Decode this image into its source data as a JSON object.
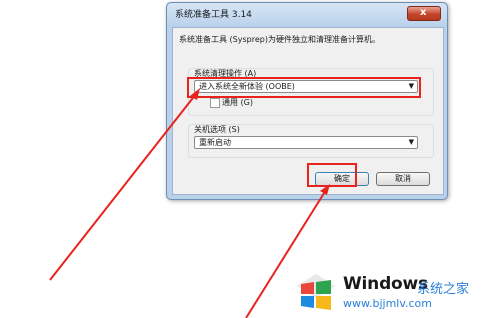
{
  "dialog": {
    "title": "系统准备工具 3.14",
    "close_label": "x",
    "description": "系统准备工具 (Sysprep)为硬件独立和清理准备计算机。",
    "cleanup_action": {
      "label": "系统清理操作 (A)",
      "selected": "进入系统全新体验 (OOBE)",
      "generalize_label": "通用 (G)",
      "generalize_checked": false
    },
    "shutdown_options": {
      "label": "关机选项 (S)",
      "selected": "重新启动"
    },
    "ok_label": "确定",
    "cancel_label": "取消"
  },
  "annotations": {
    "color": "#e8231d"
  },
  "watermark": {
    "brand": "Windows",
    "brand_cn": "系统之家",
    "url": "www.bjjmlv.com",
    "logo_colors": [
      "#e8473a",
      "#2fa44f",
      "#1b8ce0",
      "#f6b81b"
    ]
  }
}
